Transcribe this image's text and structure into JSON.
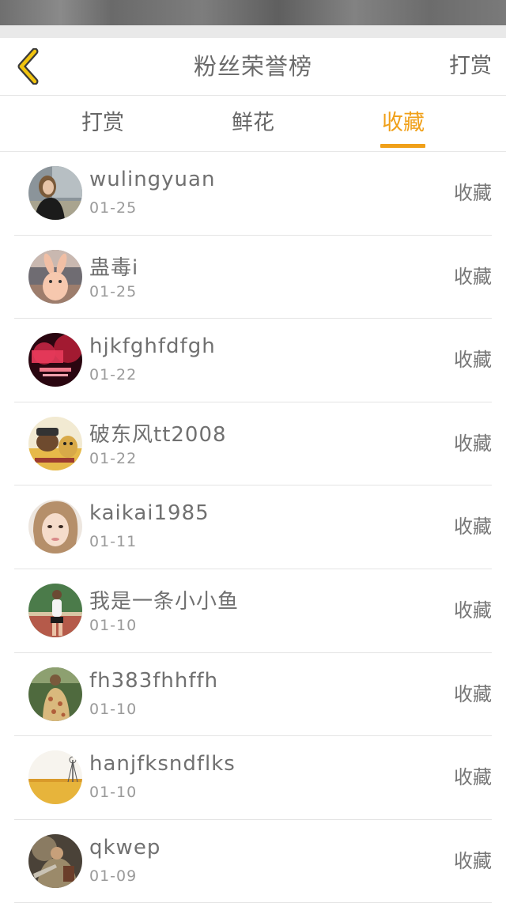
{
  "header": {
    "title": "粉丝荣誉榜",
    "right_action": "打赏"
  },
  "tabs": [
    {
      "label": "打赏",
      "active": false
    },
    {
      "label": "鲜花",
      "active": false
    },
    {
      "label": "收藏",
      "active": true
    }
  ],
  "colors": {
    "accent": "#f0a019",
    "text": "#6a6a6a",
    "divider": "#e4e4e4"
  },
  "list": [
    {
      "name": "wulingyuan",
      "date": "01-25",
      "action": "收藏",
      "avatar_icon": "avatar-photo-woman"
    },
    {
      "name": "蛊毒i",
      "date": "01-25",
      "action": "收藏",
      "avatar_icon": "avatar-photo-rabbit"
    },
    {
      "name": "hjkfghfdfgh",
      "date": "01-22",
      "action": "收藏",
      "avatar_icon": "avatar-photo-red-graphic"
    },
    {
      "name": "破东风tt2008",
      "date": "01-22",
      "action": "收藏",
      "avatar_icon": "avatar-photo-cartoon"
    },
    {
      "name": "kaikai1985",
      "date": "01-11",
      "action": "收藏",
      "avatar_icon": "avatar-photo-face"
    },
    {
      "name": "我是一条小小鱼",
      "date": "01-10",
      "action": "收藏",
      "avatar_icon": "avatar-photo-runner"
    },
    {
      "name": "fh383fhhffh",
      "date": "01-10",
      "action": "收藏",
      "avatar_icon": "avatar-photo-floral"
    },
    {
      "name": "hanjfksndflks",
      "date": "01-10",
      "action": "收藏",
      "avatar_icon": "avatar-photo-field"
    },
    {
      "name": "qkwep",
      "date": "01-09",
      "action": "收藏",
      "avatar_icon": "avatar-photo-warrior"
    }
  ]
}
